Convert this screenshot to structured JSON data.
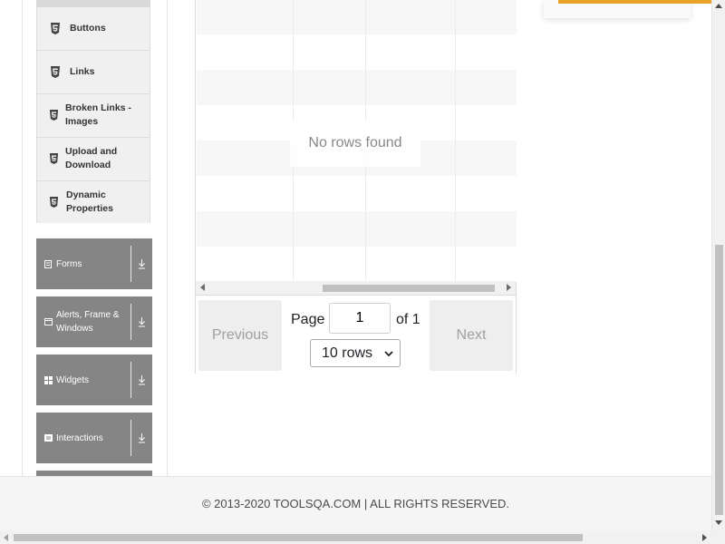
{
  "sidebar": {
    "elements_submenu": [
      {
        "label": "Buttons"
      },
      {
        "label": "Links"
      },
      {
        "label": "Broken Links - Images"
      },
      {
        "label": "Upload and Download"
      },
      {
        "label": "Dynamic Properties"
      }
    ],
    "groups": [
      {
        "label": "Forms",
        "icon": "form-icon"
      },
      {
        "label": "Alerts, Frame & Windows",
        "icon": "window-icon"
      },
      {
        "label": "Widgets",
        "icon": "widgets-icon"
      },
      {
        "label": "Interactions",
        "icon": "interactions-icon"
      }
    ]
  },
  "table": {
    "empty_message": "No rows found",
    "pagination": {
      "previous_label": "Previous",
      "next_label": "Next",
      "page_label": "Page",
      "page_value": "1",
      "of_label": "of 1",
      "rows_selected": "10 rows"
    }
  },
  "footer": {
    "copyright": "© 2013-2020 TOOLSQA.COM | ALL RIGHTS RESERVED."
  },
  "colors": {
    "group_bg": "#858585",
    "submenu_bg": "#f0f0f0",
    "ad_accent": "#e9a126"
  }
}
